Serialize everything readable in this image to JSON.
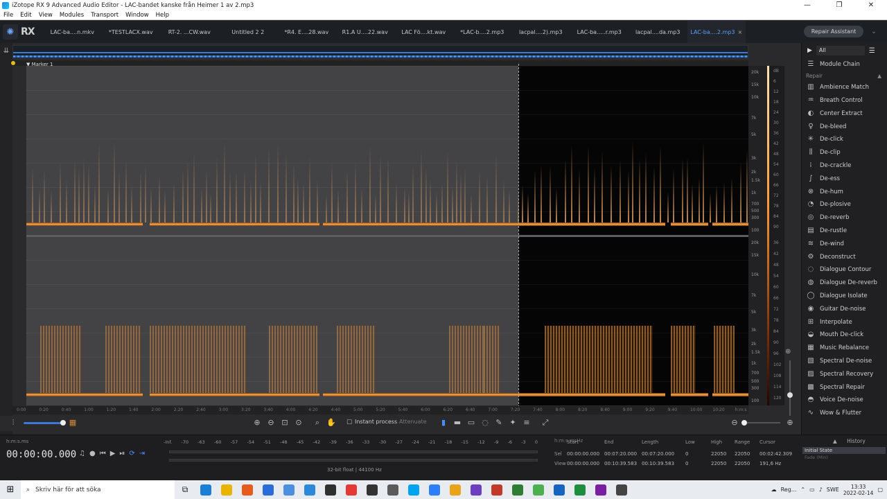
{
  "window": {
    "title": "iZotope RX 9 Advanced Audio Editor - LAC-bandet kanske från Heimer 1 av 2.mp3",
    "minimize": "—",
    "maximize": "❐",
    "close": "✕"
  },
  "menu": [
    "File",
    "Edit",
    "View",
    "Modules",
    "Transport",
    "Window",
    "Help"
  ],
  "logo": "RX",
  "tabs": [
    {
      "label": "LAC-ba....n.mkv"
    },
    {
      "label": "*TESTLACX.wav"
    },
    {
      "label": "RT-2. ...CW.wav"
    },
    {
      "label": "Untitled 2 2"
    },
    {
      "label": "*R4. E....28.wav"
    },
    {
      "label": "R1.A U....22.wav"
    },
    {
      "label": "LAC Fö....kt.wav"
    },
    {
      "label": "*LAC-b....2.mp3"
    },
    {
      "label": "lacpal....2).mp3"
    },
    {
      "label": "LAC-ba.....r.mp3"
    },
    {
      "label": "lacpal....da.mp3"
    },
    {
      "label": "LAC-ba....2.mp3",
      "active": true,
      "close": "×"
    }
  ],
  "repair_assistant": "Repair Assistant",
  "marker": "Marker 1",
  "freq_labels_top": [
    "20k",
    "15k",
    "10k",
    "7k",
    "5k",
    "3k",
    "2k",
    "1.5k",
    "1k",
    "700",
    "500",
    "300",
    "100"
  ],
  "freq_labels_bottom": [
    "20k",
    "15k",
    "10k",
    "7k",
    "5k",
    "3k",
    "2k",
    "1.5k",
    "1k",
    "700",
    "500",
    "300",
    "100"
  ],
  "db_labels_top": [
    "dB",
    "6",
    "12",
    "18",
    "24",
    "30",
    "36",
    "42",
    "48",
    "54",
    "60",
    "66",
    "72",
    "78",
    "84",
    "90"
  ],
  "db_labels_bottom": [
    "36",
    "42",
    "48",
    "54",
    "60",
    "66",
    "72",
    "78",
    "84",
    "90",
    "96",
    "102",
    "108",
    "114",
    "120"
  ],
  "time_labels": [
    "0:00",
    "0:20",
    "0:40",
    "1:00",
    "1:20",
    "1:40",
    "2:00",
    "2:20",
    "2:40",
    "3:00",
    "3:20",
    "3:40",
    "4:00",
    "4:20",
    "4:40",
    "5:00",
    "5:20",
    "5:40",
    "6:00",
    "6:20",
    "6:40",
    "7:00",
    "7:20",
    "7:40",
    "8:00",
    "8:20",
    "8:40",
    "9:00",
    "9:20",
    "9:40",
    "10:00",
    "10:20",
    "h:m:s"
  ],
  "toolbar": {
    "instant_process": "Instant process",
    "attenuate": "Attenuate"
  },
  "panel": {
    "filter": "All",
    "module_chain": "Module Chain",
    "repair_section": "Repair",
    "modules": [
      {
        "label": "Ambience Match",
        "icon": "▥"
      },
      {
        "label": "Breath Control",
        "icon": "♒"
      },
      {
        "label": "Center Extract",
        "icon": "◐"
      },
      {
        "label": "De-bleed",
        "icon": "♀"
      },
      {
        "label": "De-click",
        "icon": "✳"
      },
      {
        "label": "De-clip",
        "icon": "⫼"
      },
      {
        "label": "De-crackle",
        "icon": "⁞"
      },
      {
        "label": "De-ess",
        "icon": "∫"
      },
      {
        "label": "De-hum",
        "icon": "⊗"
      },
      {
        "label": "De-plosive",
        "icon": "◔"
      },
      {
        "label": "De-reverb",
        "icon": "◎"
      },
      {
        "label": "De-rustle",
        "icon": "▤"
      },
      {
        "label": "De-wind",
        "icon": "≋"
      },
      {
        "label": "Deconstruct",
        "icon": "⚙"
      },
      {
        "label": "Dialogue Contour",
        "icon": "◌"
      },
      {
        "label": "Dialogue De-reverb",
        "icon": "◍"
      },
      {
        "label": "Dialogue Isolate",
        "icon": "◯"
      },
      {
        "label": "Guitar De-noise",
        "icon": "◉"
      },
      {
        "label": "Interpolate",
        "icon": "⊞"
      },
      {
        "label": "Mouth De-click",
        "icon": "◒"
      },
      {
        "label": "Music Rebalance",
        "icon": "▦"
      },
      {
        "label": "Spectral De-noise",
        "icon": "▧"
      },
      {
        "label": "Spectral Recovery",
        "icon": "▨"
      },
      {
        "label": "Spectral Repair",
        "icon": "▩"
      },
      {
        "label": "Voice De-noise",
        "icon": "◓"
      },
      {
        "label": "Wow & Flutter",
        "icon": "∿"
      }
    ]
  },
  "status": {
    "time_format": "h:m:s.ms",
    "timecode": "00:00:00.000",
    "meter_scale": [
      "-Inf.",
      "-70",
      "-63",
      "-60",
      "-57",
      "-54",
      "-51",
      "-48",
      "-45",
      "-42",
      "-39",
      "-36",
      "-33",
      "-30",
      "-27",
      "-24",
      "-21",
      "-18",
      "-15",
      "-12",
      "-9",
      "-6",
      "-3",
      "0"
    ],
    "bit_info": "32-bit float | 44100 Hz",
    "selection": {
      "headers": [
        "Start",
        "End",
        "Length",
        "Low",
        "High",
        "Range",
        "Cursor"
      ],
      "sel_label": "Sel",
      "sel": [
        "00:00:00.000",
        "00:07:20.000",
        "00:07:20.000",
        "0",
        "22050",
        "22050",
        "00:02:42.309"
      ],
      "view_label": "View",
      "view": [
        "00:00:00.000",
        "00:10:39.583",
        "00:10:39.583",
        "0",
        "22050",
        "22050",
        "191,6 Hz"
      ],
      "units_time": "h:m:s.ms",
      "units_hz": "Hz"
    },
    "history_title": "History",
    "history_items": [
      "Initial State",
      "Fade (Min)"
    ]
  },
  "taskbar": {
    "search_placeholder": "Skriv här för att söka",
    "weather": "Reg...",
    "lang": "SWE",
    "time": "13:33",
    "date": "2022-02-14"
  }
}
